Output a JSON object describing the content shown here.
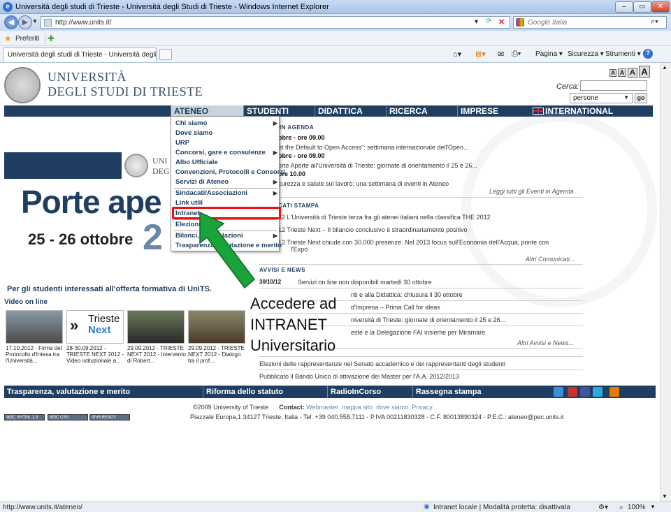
{
  "browser": {
    "title": "Università degli studi di Trieste - Università degli Studi di Trieste - Windows Internet Explorer",
    "url": "http://www.units.it/",
    "search_placeholder": "Google Italia",
    "favorites": "Preferiti",
    "tab_title": "Università degli studi di Trieste - Università degli ...",
    "tools": [
      "Pagina ▾",
      "Sicurezza ▾",
      "Strumenti ▾"
    ],
    "status_url": "http://www.units.it/ateneo/",
    "status_zone": "Intranet locale | Modalità protetta: disattivata",
    "zoom": "100%"
  },
  "site": {
    "name_line1": "UNIVERSITÀ",
    "name_line2": "DEGLI STUDI DI TRIESTE",
    "cerca_label": "Cerca:",
    "search_scope": "persone",
    "go_label": "go",
    "text_sizes": [
      "A",
      "A",
      "A",
      "A"
    ]
  },
  "nav": [
    "ATENEO",
    "STUDENTI",
    "DIDATTICA",
    "RICERCA",
    "IMPRESE",
    "INTERNATIONAL"
  ],
  "dropdown": [
    "Chi siamo",
    "Dove siamo",
    "URP",
    "Concorsi, gare e consulenze",
    "Albo Ufficiale",
    "Convenzioni, Protocolli e Consorzi",
    "Servizi di Ateneo",
    "Sindacati/Associazioni",
    "Link utili",
    "Intranet",
    "Elezioni",
    "Bilanci, ... e Relazioni",
    "Trasparenza, valutazione e merito"
  ],
  "banner": {
    "logo_line1": "UNI",
    "logo_line2": "DEG",
    "headline": "Porte ape",
    "dates": "25 - 26 ottobre",
    "digit": "2",
    "offerta": "Per gli studenti interessati all'offerta formativa di UniTS.",
    "video_label": "Video on line"
  },
  "videos": [
    {
      "caption": "17.10.2012 - Firma del Protocollo d'Intesa tra l'Università..."
    },
    {
      "caption": "28-30.09.2012 - TRIESTE NEXT 2012 - Video istituzionale a..."
    },
    {
      "caption": "29.09.2012 - TRIESTE NEXT 2012 - Intervento di Robert..."
    },
    {
      "caption": "29.09.2012 - TRIESTE NEXT 2012 - Dialogo tra il prof...."
    }
  ],
  "agenda": {
    "heading": "IN AGENDA",
    "items": [
      "obre - ore 09.00",
      "et the Default to Open Access\": settimana internazionale dell'Open...",
      "obre - ore 09.00",
      "orte Aperte all'Università di Trieste: giornate di orientamento il 25 e 26...",
      "ore 10.00",
      "curezza e salute sul lavoro: una settimana di eventi in Ateneo"
    ],
    "more": "Leggi tutti gli Eventi in Agenda"
  },
  "stampa": {
    "heading": "CATI STAMPA",
    "items": [
      "12   L'Università di Trieste terza fra gli atenei italiani nella classifica THE 2012",
      "12   Trieste Next – Il bilancio conclusivo è straordinariamente positivo",
      "12   Trieste Next chiude con 30.000 presenze. Nel 2013 focus sull'Economia dell'Acqua, ponte con",
      "l'Expo"
    ],
    "more": "Altri Comunicati..."
  },
  "avvisi": {
    "heading": "AVVISI E NEWS",
    "items": [
      {
        "date": "30/10/12",
        "text": "Servizi on line non disponibili martedì 30 ottobre"
      },
      {
        "date": "",
        "text": "nti e alla Didattica: chiusura il 30 ottobre"
      },
      {
        "date": "",
        "text": "d'Impresa – Prima Call for ideas"
      },
      {
        "date": "",
        "text": "niversità di Trieste: giornate di orientamento il 25 e 26..."
      },
      {
        "date": "",
        "text": "este e la Delegazione FAI insieme per Miramare"
      }
    ],
    "more": "Altri Avvisi e News...",
    "extra": [
      "Elezioni delle rappresentanze nel Senato accademico e dei rappresentanti degli studenti",
      "Pubblicato il Bando Unico di attivazione dei Master per l'A.A. 2012/2013"
    ]
  },
  "annotation": [
    "Accedere ad",
    "INTRANET",
    "Universitario"
  ],
  "footer": {
    "bar": [
      "Trasparenza, valutazione e merito",
      "Riforma dello statuto",
      "RadioInCorso",
      "Rassegna stampa"
    ],
    "copyright": "©2009 University of Trieste",
    "contact_label": "Contact:",
    "links": [
      "Webmaster",
      "mappa sito",
      "dove siamo",
      "Privacy"
    ],
    "address": "Piazzale Europa,1 34127 Trieste, Italia - Tel. +39 040.558.7111  -  P.IVA 00211830328 - C.F. 80013890324 - P.E.C.: ateneo@pec.units.it",
    "badges": [
      "W3C XHTML 1.0",
      "W3C CSS",
      "IPV6 READY"
    ]
  },
  "colors": {
    "navy": "#1f3e62",
    "highlight": "#e11111",
    "arrow": "#1aa33a"
  }
}
